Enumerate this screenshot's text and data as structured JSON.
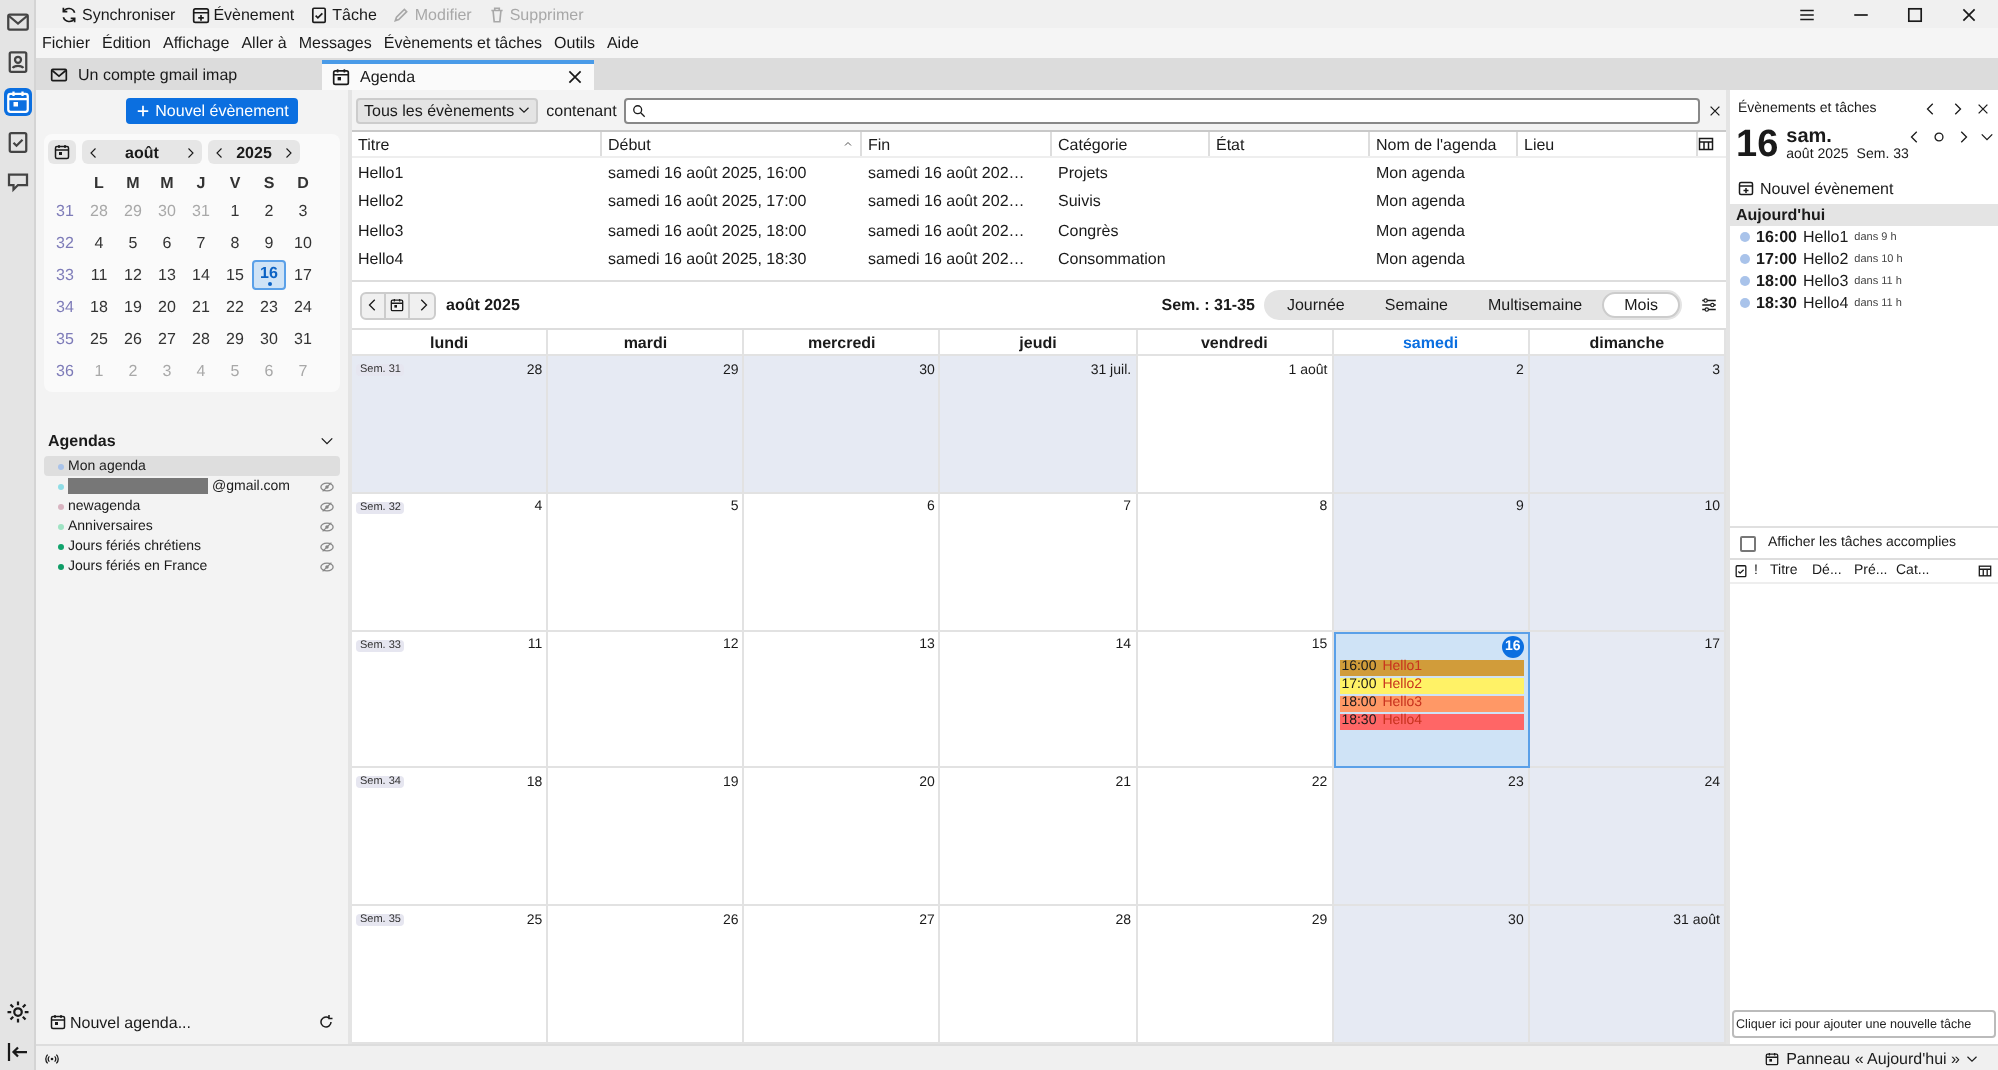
{
  "toolbar": [
    {
      "label": "Synchroniser",
      "kind": "sync",
      "disabled": false
    },
    {
      "label": "Évènement",
      "kind": "event",
      "disabled": false
    },
    {
      "label": "Tâche",
      "kind": "task",
      "disabled": false
    },
    {
      "label": "Modifier",
      "kind": "edit",
      "disabled": true
    },
    {
      "label": "Supprimer",
      "kind": "delete",
      "disabled": true
    }
  ],
  "menu": [
    "Fichier",
    "Édition",
    "Affichage",
    "Aller à",
    "Messages",
    "Évènements et tâches",
    "Outils",
    "Aide"
  ],
  "spaces": [
    {
      "kind": "mail",
      "selected": false
    },
    {
      "kind": "contacts",
      "selected": false
    },
    {
      "kind": "calendar",
      "selected": true
    },
    {
      "kind": "tasks",
      "selected": false
    },
    {
      "kind": "chat",
      "selected": false
    }
  ],
  "tabs": [
    {
      "label": "Un compte gmail imap",
      "kind": "mail",
      "selected": false
    },
    {
      "label": "Agenda",
      "kind": "calendar",
      "selected": true
    }
  ],
  "left_pane": {
    "new_event": "Nouvel évènement",
    "minical": {
      "month": "août",
      "year": "2025",
      "weekdays": [
        "L",
        "M",
        "M",
        "J",
        "V",
        "S",
        "D"
      ],
      "weeks": [
        {
          "number": "31",
          "days": [
            {
              "label": "28",
              "other_month": true,
              "selected": false
            },
            {
              "label": "29",
              "other_month": true,
              "selected": false
            },
            {
              "label": "30",
              "other_month": true,
              "selected": false
            },
            {
              "label": "31",
              "other_month": true,
              "selected": false
            },
            {
              "label": "1",
              "other_month": false,
              "selected": false
            },
            {
              "label": "2",
              "other_month": false,
              "selected": false
            },
            {
              "label": "3",
              "other_month": false,
              "selected": false
            }
          ]
        },
        {
          "number": "32",
          "days": [
            {
              "label": "4",
              "other_month": false,
              "selected": false
            },
            {
              "label": "5",
              "other_month": false,
              "selected": false
            },
            {
              "label": "6",
              "other_month": false,
              "selected": false
            },
            {
              "label": "7",
              "other_month": false,
              "selected": false
            },
            {
              "label": "8",
              "other_month": false,
              "selected": false
            },
            {
              "label": "9",
              "other_month": false,
              "selected": false
            },
            {
              "label": "10",
              "other_month": false,
              "selected": false
            }
          ]
        },
        {
          "number": "33",
          "days": [
            {
              "label": "11",
              "other_month": false,
              "selected": false
            },
            {
              "label": "12",
              "other_month": false,
              "selected": false
            },
            {
              "label": "13",
              "other_month": false,
              "selected": false
            },
            {
              "label": "14",
              "other_month": false,
              "selected": false
            },
            {
              "label": "15",
              "other_month": false,
              "selected": false
            },
            {
              "label": "16",
              "other_month": false,
              "selected": true
            },
            {
              "label": "17",
              "other_month": false,
              "selected": false
            }
          ]
        },
        {
          "number": "34",
          "days": [
            {
              "label": "18",
              "other_month": false,
              "selected": false
            },
            {
              "label": "19",
              "other_month": false,
              "selected": false
            },
            {
              "label": "20",
              "other_month": false,
              "selected": false
            },
            {
              "label": "21",
              "other_month": false,
              "selected": false
            },
            {
              "label": "22",
              "other_month": false,
              "selected": false
            },
            {
              "label": "23",
              "other_month": false,
              "selected": false
            },
            {
              "label": "24",
              "other_month": false,
              "selected": false
            }
          ]
        },
        {
          "number": "35",
          "days": [
            {
              "label": "25",
              "other_month": false,
              "selected": false
            },
            {
              "label": "26",
              "other_month": false,
              "selected": false
            },
            {
              "label": "27",
              "other_month": false,
              "selected": false
            },
            {
              "label": "28",
              "other_month": false,
              "selected": false
            },
            {
              "label": "29",
              "other_month": false,
              "selected": false
            },
            {
              "label": "30",
              "other_month": false,
              "selected": false
            },
            {
              "label": "31",
              "other_month": false,
              "selected": false
            }
          ]
        },
        {
          "number": "36",
          "days": [
            {
              "label": "1",
              "other_month": true,
              "selected": false
            },
            {
              "label": "2",
              "other_month": true,
              "selected": false
            },
            {
              "label": "3",
              "other_month": true,
              "selected": false
            },
            {
              "label": "4",
              "other_month": true,
              "selected": false
            },
            {
              "label": "5",
              "other_month": true,
              "selected": false
            },
            {
              "label": "6",
              "other_month": true,
              "selected": false
            },
            {
              "label": "7",
              "other_month": true,
              "selected": false
            }
          ]
        }
      ]
    },
    "calendars_title": "Agendas",
    "calendars": [
      {
        "name": "Mon agenda",
        "color": "#a9c3ea",
        "selected": true,
        "redacted": false,
        "shared": false
      },
      {
        "name": "@gmail.com",
        "color": "#8fdde6",
        "selected": false,
        "redacted": true,
        "shared": true
      },
      {
        "name": "newagenda",
        "color": "#d9b3c0",
        "selected": false,
        "redacted": false,
        "shared": true
      },
      {
        "name": "Anniversaires",
        "color": "#9ee3c3",
        "selected": false,
        "redacted": false,
        "shared": true
      },
      {
        "name": "Jours fériés chrétiens",
        "color": "#10a36c",
        "selected": false,
        "redacted": false,
        "shared": true
      },
      {
        "name": "Jours fériés en France",
        "color": "#0e9c66",
        "selected": false,
        "redacted": false,
        "shared": true
      }
    ],
    "new_calendar": "Nouvel agenda..."
  },
  "filter": {
    "scope": "Tous les évènements",
    "label": "contenant"
  },
  "events_table": {
    "columns": [
      {
        "label": "Titre",
        "sorted": false
      },
      {
        "label": "Début",
        "sorted": true
      },
      {
        "label": "Fin",
        "sorted": false
      },
      {
        "label": "Catégorie",
        "sorted": false
      },
      {
        "label": "État",
        "sorted": false
      },
      {
        "label": "Nom de l'agenda",
        "sorted": false
      },
      {
        "label": "Lieu",
        "sorted": false
      }
    ],
    "rows": [
      [
        "Hello1",
        "samedi 16 août 2025, 16:00",
        "samedi 16 août 202…",
        "Projets",
        "",
        "Mon agenda",
        ""
      ],
      [
        "Hello2",
        "samedi 16 août 2025, 17:00",
        "samedi 16 août 202…",
        "Suivis",
        "",
        "Mon agenda",
        ""
      ],
      [
        "Hello3",
        "samedi 16 août 2025, 18:00",
        "samedi 16 août 202…",
        "Congrès",
        "",
        "Mon agenda",
        ""
      ],
      [
        "Hello4",
        "samedi 16 août 2025, 18:30",
        "samedi 16 août 202…",
        "Consommation",
        "",
        "Mon agenda",
        ""
      ]
    ]
  },
  "month_view": {
    "title": "août 2025",
    "weeks_label": "Sem. : 31-35",
    "views": [
      {
        "label": "Journée",
        "selected": false
      },
      {
        "label": "Semaine",
        "selected": false
      },
      {
        "label": "Multisemaine",
        "selected": false
      },
      {
        "label": "Mois",
        "selected": true
      }
    ],
    "weekdays": [
      {
        "label": "lundi",
        "today": false
      },
      {
        "label": "mardi",
        "today": false
      },
      {
        "label": "mercredi",
        "today": false
      },
      {
        "label": "jeudi",
        "today": false
      },
      {
        "label": "vendredi",
        "today": false
      },
      {
        "label": "samedi",
        "today": true
      },
      {
        "label": "dimanche",
        "today": false
      }
    ],
    "weeks": [
      {
        "label": "Sem. 31",
        "days": [
          {
            "label": "28",
            "dimmed": true,
            "today": false
          },
          {
            "label": "29",
            "dimmed": true,
            "today": false
          },
          {
            "label": "30",
            "dimmed": true,
            "today": false
          },
          {
            "label": "31 juil.",
            "dimmed": true,
            "today": false
          },
          {
            "label": "1 août",
            "dimmed": false,
            "today": false
          },
          {
            "label": "2",
            "dimmed": true,
            "today": false
          },
          {
            "label": "3",
            "dimmed": true,
            "today": false
          }
        ]
      },
      {
        "label": "Sem. 32",
        "days": [
          {
            "label": "4",
            "dimmed": false,
            "today": false
          },
          {
            "label": "5",
            "dimmed": false,
            "today": false
          },
          {
            "label": "6",
            "dimmed": false,
            "today": false
          },
          {
            "label": "7",
            "dimmed": false,
            "today": false
          },
          {
            "label": "8",
            "dimmed": false,
            "today": false
          },
          {
            "label": "9",
            "dimmed": true,
            "today": false
          },
          {
            "label": "10",
            "dimmed": true,
            "today": false
          }
        ]
      },
      {
        "label": "Sem. 33",
        "days": [
          {
            "label": "11",
            "dimmed": false,
            "today": false
          },
          {
            "label": "12",
            "dimmed": false,
            "today": false
          },
          {
            "label": "13",
            "dimmed": false,
            "today": false
          },
          {
            "label": "14",
            "dimmed": false,
            "today": false
          },
          {
            "label": "15",
            "dimmed": false,
            "today": false
          },
          {
            "label": "16",
            "dimmed": false,
            "today": true,
            "events": [
              {
                "time": "16:00",
                "title": "Hello1",
                "color": "#d19c3a"
              },
              {
                "time": "17:00",
                "title": "Hello2",
                "color": "#fff266"
              },
              {
                "time": "18:00",
                "title": "Hello3",
                "color": "#ff9866"
              },
              {
                "time": "18:30",
                "title": "Hello4",
                "color": "#ff6666"
              }
            ]
          },
          {
            "label": "17",
            "dimmed": true,
            "today": false
          }
        ]
      },
      {
        "label": "Sem. 34",
        "days": [
          {
            "label": "18",
            "dimmed": false,
            "today": false
          },
          {
            "label": "19",
            "dimmed": false,
            "today": false
          },
          {
            "label": "20",
            "dimmed": false,
            "today": false
          },
          {
            "label": "21",
            "dimmed": false,
            "today": false
          },
          {
            "label": "22",
            "dimmed": false,
            "today": false
          },
          {
            "label": "23",
            "dimmed": true,
            "today": false
          },
          {
            "label": "24",
            "dimmed": true,
            "today": false
          }
        ]
      },
      {
        "label": "Sem. 35",
        "days": [
          {
            "label": "25",
            "dimmed": false,
            "today": false
          },
          {
            "label": "26",
            "dimmed": false,
            "today": false
          },
          {
            "label": "27",
            "dimmed": false,
            "today": false
          },
          {
            "label": "28",
            "dimmed": false,
            "today": false
          },
          {
            "label": "29",
            "dimmed": false,
            "today": false
          },
          {
            "label": "30",
            "dimmed": true,
            "today": false
          },
          {
            "label": "31 août",
            "dimmed": true,
            "today": false
          }
        ]
      }
    ]
  },
  "today_pane": {
    "title": "Évènements et tâches",
    "day": "16",
    "weekday": "sam.",
    "month_year": "août 2025",
    "week": "Sem. 33",
    "new_event": "Nouvel évènement",
    "section": "Aujourd'hui",
    "agenda": [
      {
        "time": "16:00",
        "title": "Hello1",
        "relative": "dans 9 h",
        "color": "#a9c3ea"
      },
      {
        "time": "17:00",
        "title": "Hello2",
        "relative": "dans 10 h",
        "color": "#a9c3ea"
      },
      {
        "time": "18:00",
        "title": "Hello3",
        "relative": "dans 11 h",
        "color": "#a9c3ea"
      },
      {
        "time": "18:30",
        "title": "Hello4",
        "relative": "dans 11 h",
        "color": "#a9c3ea"
      }
    ],
    "show_completed": {
      "label": "Afficher les tâches accomplies",
      "checked": false
    },
    "task_columns": [
      "!",
      "Titre",
      "Dé...",
      "Pré...",
      "Cat..."
    ],
    "new_task_placeholder": "Cliquer ici pour ajouter une nouvelle tâche"
  },
  "status_bar": {
    "today_pane": "Panneau « Aujourd'hui »"
  }
}
